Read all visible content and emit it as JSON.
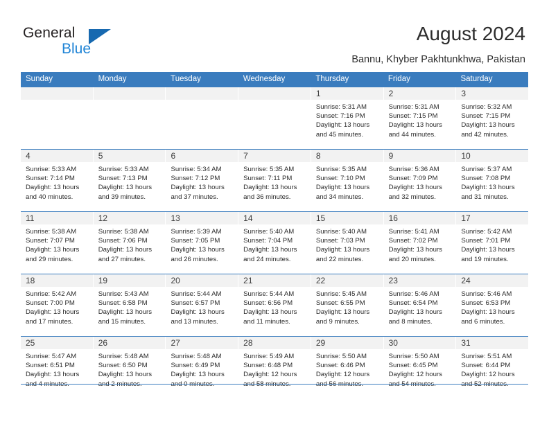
{
  "logo": {
    "primary_text": "General",
    "secondary_text": "Blue",
    "triangle_color": "#1769b0",
    "blue_color": "#1f84d6"
  },
  "header": {
    "title": "August 2024",
    "subtitle": "Bannu, Khyber Pakhtunkhwa, Pakistan"
  },
  "theme": {
    "header_blue": "#3a7cbe",
    "day_band_gray": "#f2f2f2",
    "text_color": "#2a2a2a"
  },
  "calendar": {
    "weekdays": [
      "Sunday",
      "Monday",
      "Tuesday",
      "Wednesday",
      "Thursday",
      "Friday",
      "Saturday"
    ],
    "weeks": [
      [
        {
          "day": "",
          "sunrise": "",
          "sunset": "",
          "daylight_line1": "",
          "daylight_line2": ""
        },
        {
          "day": "",
          "sunrise": "",
          "sunset": "",
          "daylight_line1": "",
          "daylight_line2": ""
        },
        {
          "day": "",
          "sunrise": "",
          "sunset": "",
          "daylight_line1": "",
          "daylight_line2": ""
        },
        {
          "day": "",
          "sunrise": "",
          "sunset": "",
          "daylight_line1": "",
          "daylight_line2": ""
        },
        {
          "day": "1",
          "sunrise": "Sunrise: 5:31 AM",
          "sunset": "Sunset: 7:16 PM",
          "daylight_line1": "Daylight: 13 hours",
          "daylight_line2": "and 45 minutes."
        },
        {
          "day": "2",
          "sunrise": "Sunrise: 5:31 AM",
          "sunset": "Sunset: 7:15 PM",
          "daylight_line1": "Daylight: 13 hours",
          "daylight_line2": "and 44 minutes."
        },
        {
          "day": "3",
          "sunrise": "Sunrise: 5:32 AM",
          "sunset": "Sunset: 7:15 PM",
          "daylight_line1": "Daylight: 13 hours",
          "daylight_line2": "and 42 minutes."
        }
      ],
      [
        {
          "day": "4",
          "sunrise": "Sunrise: 5:33 AM",
          "sunset": "Sunset: 7:14 PM",
          "daylight_line1": "Daylight: 13 hours",
          "daylight_line2": "and 40 minutes."
        },
        {
          "day": "5",
          "sunrise": "Sunrise: 5:33 AM",
          "sunset": "Sunset: 7:13 PM",
          "daylight_line1": "Daylight: 13 hours",
          "daylight_line2": "and 39 minutes."
        },
        {
          "day": "6",
          "sunrise": "Sunrise: 5:34 AM",
          "sunset": "Sunset: 7:12 PM",
          "daylight_line1": "Daylight: 13 hours",
          "daylight_line2": "and 37 minutes."
        },
        {
          "day": "7",
          "sunrise": "Sunrise: 5:35 AM",
          "sunset": "Sunset: 7:11 PM",
          "daylight_line1": "Daylight: 13 hours",
          "daylight_line2": "and 36 minutes."
        },
        {
          "day": "8",
          "sunrise": "Sunrise: 5:35 AM",
          "sunset": "Sunset: 7:10 PM",
          "daylight_line1": "Daylight: 13 hours",
          "daylight_line2": "and 34 minutes."
        },
        {
          "day": "9",
          "sunrise": "Sunrise: 5:36 AM",
          "sunset": "Sunset: 7:09 PM",
          "daylight_line1": "Daylight: 13 hours",
          "daylight_line2": "and 32 minutes."
        },
        {
          "day": "10",
          "sunrise": "Sunrise: 5:37 AM",
          "sunset": "Sunset: 7:08 PM",
          "daylight_line1": "Daylight: 13 hours",
          "daylight_line2": "and 31 minutes."
        }
      ],
      [
        {
          "day": "11",
          "sunrise": "Sunrise: 5:38 AM",
          "sunset": "Sunset: 7:07 PM",
          "daylight_line1": "Daylight: 13 hours",
          "daylight_line2": "and 29 minutes."
        },
        {
          "day": "12",
          "sunrise": "Sunrise: 5:38 AM",
          "sunset": "Sunset: 7:06 PM",
          "daylight_line1": "Daylight: 13 hours",
          "daylight_line2": "and 27 minutes."
        },
        {
          "day": "13",
          "sunrise": "Sunrise: 5:39 AM",
          "sunset": "Sunset: 7:05 PM",
          "daylight_line1": "Daylight: 13 hours",
          "daylight_line2": "and 26 minutes."
        },
        {
          "day": "14",
          "sunrise": "Sunrise: 5:40 AM",
          "sunset": "Sunset: 7:04 PM",
          "daylight_line1": "Daylight: 13 hours",
          "daylight_line2": "and 24 minutes."
        },
        {
          "day": "15",
          "sunrise": "Sunrise: 5:40 AM",
          "sunset": "Sunset: 7:03 PM",
          "daylight_line1": "Daylight: 13 hours",
          "daylight_line2": "and 22 minutes."
        },
        {
          "day": "16",
          "sunrise": "Sunrise: 5:41 AM",
          "sunset": "Sunset: 7:02 PM",
          "daylight_line1": "Daylight: 13 hours",
          "daylight_line2": "and 20 minutes."
        },
        {
          "day": "17",
          "sunrise": "Sunrise: 5:42 AM",
          "sunset": "Sunset: 7:01 PM",
          "daylight_line1": "Daylight: 13 hours",
          "daylight_line2": "and 19 minutes."
        }
      ],
      [
        {
          "day": "18",
          "sunrise": "Sunrise: 5:42 AM",
          "sunset": "Sunset: 7:00 PM",
          "daylight_line1": "Daylight: 13 hours",
          "daylight_line2": "and 17 minutes."
        },
        {
          "day": "19",
          "sunrise": "Sunrise: 5:43 AM",
          "sunset": "Sunset: 6:58 PM",
          "daylight_line1": "Daylight: 13 hours",
          "daylight_line2": "and 15 minutes."
        },
        {
          "day": "20",
          "sunrise": "Sunrise: 5:44 AM",
          "sunset": "Sunset: 6:57 PM",
          "daylight_line1": "Daylight: 13 hours",
          "daylight_line2": "and 13 minutes."
        },
        {
          "day": "21",
          "sunrise": "Sunrise: 5:44 AM",
          "sunset": "Sunset: 6:56 PM",
          "daylight_line1": "Daylight: 13 hours",
          "daylight_line2": "and 11 minutes."
        },
        {
          "day": "22",
          "sunrise": "Sunrise: 5:45 AM",
          "sunset": "Sunset: 6:55 PM",
          "daylight_line1": "Daylight: 13 hours",
          "daylight_line2": "and 9 minutes."
        },
        {
          "day": "23",
          "sunrise": "Sunrise: 5:46 AM",
          "sunset": "Sunset: 6:54 PM",
          "daylight_line1": "Daylight: 13 hours",
          "daylight_line2": "and 8 minutes."
        },
        {
          "day": "24",
          "sunrise": "Sunrise: 5:46 AM",
          "sunset": "Sunset: 6:53 PM",
          "daylight_line1": "Daylight: 13 hours",
          "daylight_line2": "and 6 minutes."
        }
      ],
      [
        {
          "day": "25",
          "sunrise": "Sunrise: 5:47 AM",
          "sunset": "Sunset: 6:51 PM",
          "daylight_line1": "Daylight: 13 hours",
          "daylight_line2": "and 4 minutes."
        },
        {
          "day": "26",
          "sunrise": "Sunrise: 5:48 AM",
          "sunset": "Sunset: 6:50 PM",
          "daylight_line1": "Daylight: 13 hours",
          "daylight_line2": "and 2 minutes."
        },
        {
          "day": "27",
          "sunrise": "Sunrise: 5:48 AM",
          "sunset": "Sunset: 6:49 PM",
          "daylight_line1": "Daylight: 13 hours",
          "daylight_line2": "and 0 minutes."
        },
        {
          "day": "28",
          "sunrise": "Sunrise: 5:49 AM",
          "sunset": "Sunset: 6:48 PM",
          "daylight_line1": "Daylight: 12 hours",
          "daylight_line2": "and 58 minutes."
        },
        {
          "day": "29",
          "sunrise": "Sunrise: 5:50 AM",
          "sunset": "Sunset: 6:46 PM",
          "daylight_line1": "Daylight: 12 hours",
          "daylight_line2": "and 56 minutes."
        },
        {
          "day": "30",
          "sunrise": "Sunrise: 5:50 AM",
          "sunset": "Sunset: 6:45 PM",
          "daylight_line1": "Daylight: 12 hours",
          "daylight_line2": "and 54 minutes."
        },
        {
          "day": "31",
          "sunrise": "Sunrise: 5:51 AM",
          "sunset": "Sunset: 6:44 PM",
          "daylight_line1": "Daylight: 12 hours",
          "daylight_line2": "and 52 minutes."
        }
      ]
    ]
  }
}
